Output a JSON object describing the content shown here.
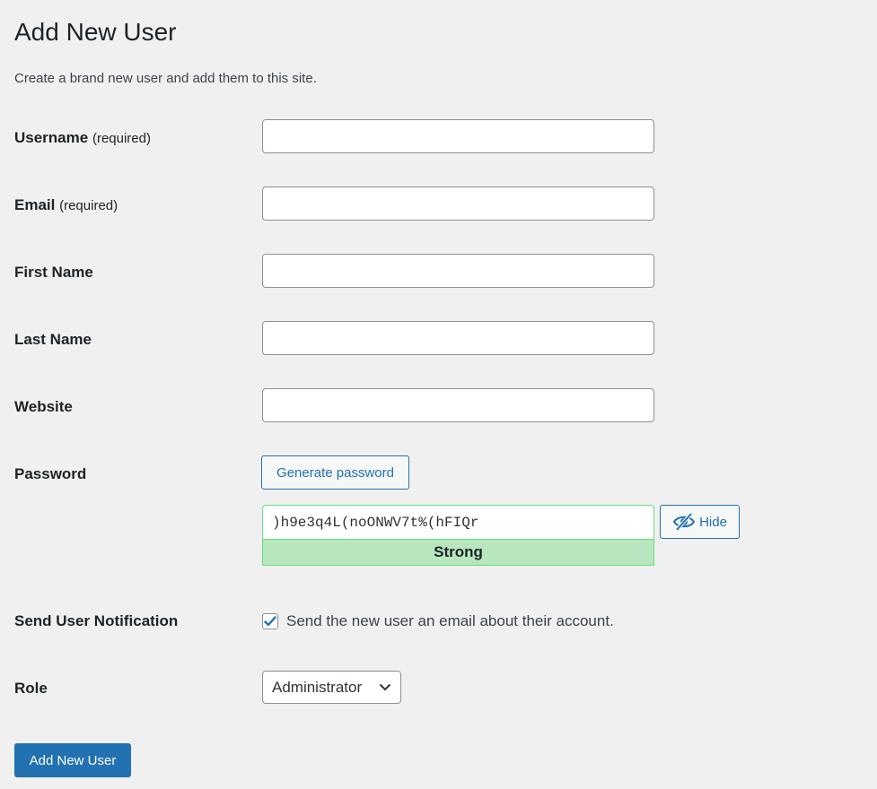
{
  "page": {
    "title": "Add New User",
    "description": "Create a brand new user and add them to this site."
  },
  "fields": {
    "username": {
      "label": "Username",
      "required_note": "(required)",
      "value": ""
    },
    "email": {
      "label": "Email",
      "required_note": "(required)",
      "value": ""
    },
    "first_name": {
      "label": "First Name",
      "value": ""
    },
    "last_name": {
      "label": "Last Name",
      "value": ""
    },
    "website": {
      "label": "Website",
      "value": ""
    }
  },
  "password": {
    "label": "Password",
    "generate_label": "Generate password",
    "value": ")h9e3q4L(noONWV7t%(hFIQr",
    "strength": "Strong",
    "hide_label": "Hide",
    "hide_icon": "eye-slash-icon"
  },
  "notification": {
    "label": "Send User Notification",
    "checkbox_label": "Send the new user an email about their account.",
    "checked": true
  },
  "role": {
    "label": "Role",
    "selected": "Administrator"
  },
  "submit": {
    "label": "Add New User"
  },
  "colors": {
    "accent": "#2271b1",
    "strong_bg": "#b8e6bf",
    "strong_border": "#68de7c",
    "page_bg": "#f0f0f1"
  }
}
